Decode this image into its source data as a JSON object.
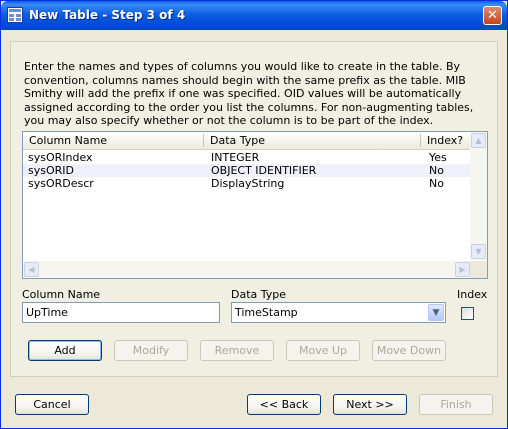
{
  "window": {
    "title": "New Table - Step 3 of 4",
    "close_glyph": "✕"
  },
  "instructions": "Enter the names and types of columns you would like to create in the table. By convention, columns names should begin with the same prefix as the table. MIB Smithy will add the prefix if one was specified. OID values will be automatically assigned according to the order you list the columns. For non-augmenting tables, you may also specify whether or not the column is to be part of the index.",
  "table": {
    "headers": [
      "Column Name",
      "Data Type",
      "Index?"
    ],
    "rows": [
      [
        "sysORIndex",
        "INTEGER",
        "Yes"
      ],
      [
        "sysORID",
        "OBJECT IDENTIFIER",
        "No"
      ],
      [
        "sysORDescr",
        "DisplayString",
        "No"
      ]
    ]
  },
  "form": {
    "column_name_label": "Column Name",
    "column_name_value": "UpTime",
    "data_type_label": "Data Type",
    "data_type_value": "TimeStamp",
    "index_label": "Index",
    "index_checked": false
  },
  "row_buttons": {
    "add": "Add",
    "modify": "Modify",
    "remove": "Remove",
    "move_up": "Move Up",
    "move_down": "Move Down"
  },
  "footer": {
    "cancel": "Cancel",
    "back": "<< Back",
    "next": "Next >>",
    "finish": "Finish"
  },
  "icons": {
    "app": "table-icon",
    "close": "close-icon",
    "scroll_up": "arrow-up-icon",
    "scroll_down": "arrow-down-icon",
    "scroll_left": "arrow-left-icon",
    "scroll_right": "arrow-right-icon",
    "dropdown": "chevron-down-icon"
  },
  "colors": {
    "titlebar": "#0551d8",
    "window_bg": "#ece9d8",
    "alt_row": "#eef1f9"
  }
}
